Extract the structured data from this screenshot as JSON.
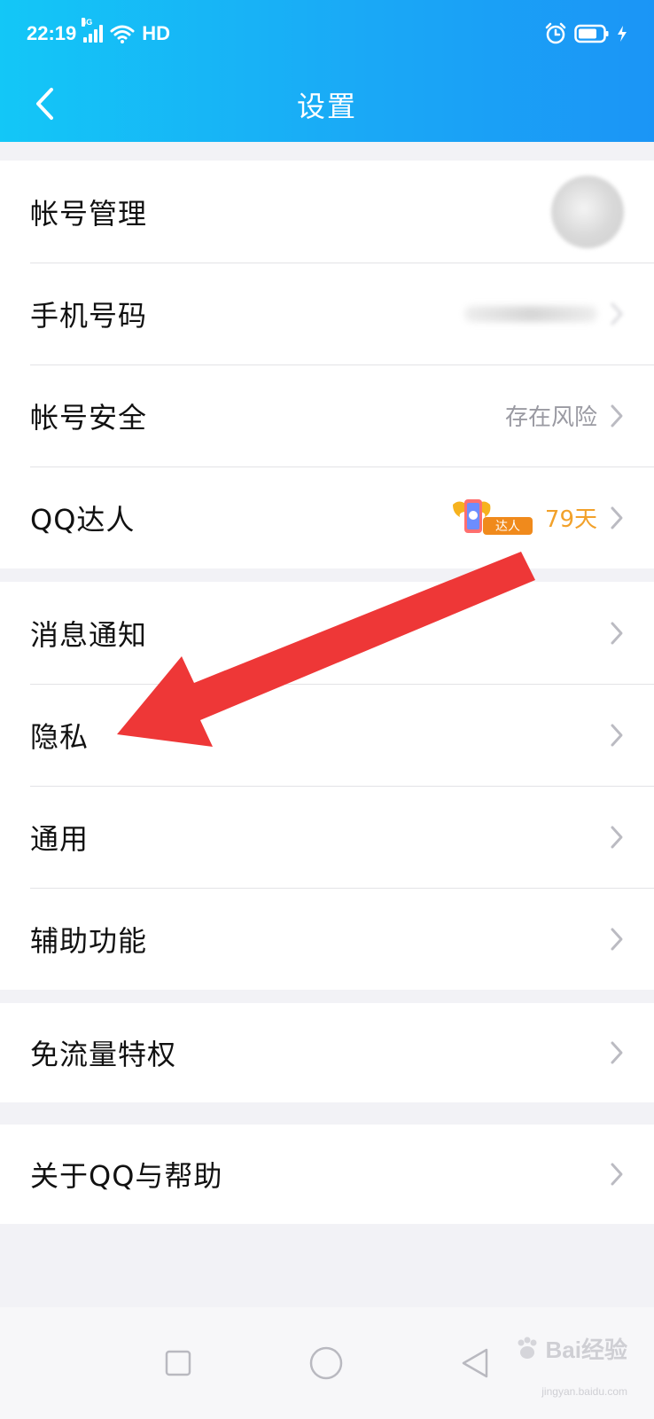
{
  "status_bar": {
    "time": "22:19",
    "network": "4G",
    "hd": "HD"
  },
  "header": {
    "title": "设置",
    "back_icon": "chevron-left-icon"
  },
  "groups": [
    {
      "items": [
        {
          "label": "帐号管理",
          "value": "",
          "accessory": "avatar"
        },
        {
          "label": "手机号码",
          "value": "",
          "accessory": "blurred-value"
        },
        {
          "label": "帐号安全",
          "value": "存在风险",
          "accessory": "chevron"
        },
        {
          "label": "QQ达人",
          "value": "79天",
          "badge_text": "达人",
          "accessory": "chevron"
        }
      ]
    },
    {
      "items": [
        {
          "label": "消息通知"
        },
        {
          "label": "隐私"
        },
        {
          "label": "通用"
        },
        {
          "label": "辅助功能"
        }
      ]
    },
    {
      "items": [
        {
          "label": "免流量特权"
        }
      ]
    },
    {
      "items": [
        {
          "label": "关于QQ与帮助"
        }
      ]
    }
  ],
  "watermark": {
    "brand": "Bai经验",
    "sub": "jingyan.baidu.com"
  },
  "colors": {
    "header_start": "#13c7f7",
    "header_end": "#1b95f6",
    "risk_text": "#9a9aa2",
    "vip_days": "#f2a12a",
    "arrow": "#ee3737"
  }
}
